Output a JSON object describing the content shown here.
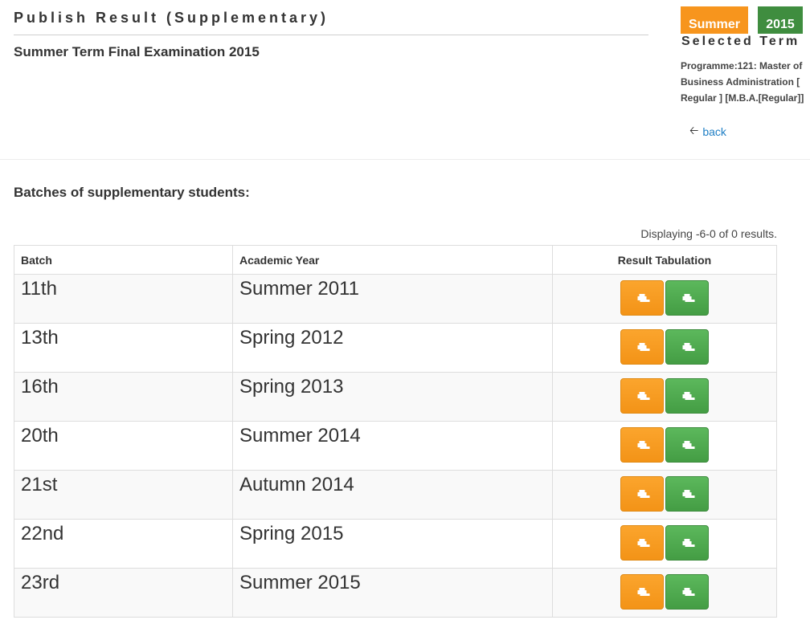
{
  "page": {
    "title": "Publish Result (Supplementary)",
    "exam_title": "Summer Term Final Examination 2015"
  },
  "term": {
    "season": "Summer",
    "year": "2015",
    "label": "Selected Term",
    "programme": "Programme:121: Master of Business Administration [ Regular ] [M.B.A.[Regular]]",
    "back_label": "back",
    "back_icon": "arrow-left-icon"
  },
  "section": {
    "heading": "Batches of supplementary students:",
    "summary": "Displaying -6-0 of 0 results."
  },
  "table": {
    "headers": {
      "batch": "Batch",
      "academic_year": "Academic Year",
      "result": "Result Tabulation"
    },
    "rows": [
      {
        "batch": "11th",
        "academic_year": "Summer 2011"
      },
      {
        "batch": "13th",
        "academic_year": "Spring 2012"
      },
      {
        "batch": "16th",
        "academic_year": "Spring 2013"
      },
      {
        "batch": "20th",
        "academic_year": "Summer 2014"
      },
      {
        "batch": "21st",
        "academic_year": "Autumn 2014"
      },
      {
        "batch": "22nd",
        "academic_year": "Spring 2015"
      },
      {
        "batch": "23rd",
        "academic_year": "Summer 2015"
      }
    ],
    "action_icon": "printer-icon"
  },
  "colors": {
    "badge_term": "#f7951d",
    "badge_year": "#3f8d3f",
    "button_orange": "#f39317",
    "button_green": "#449d44",
    "link": "#1f7fc5"
  }
}
